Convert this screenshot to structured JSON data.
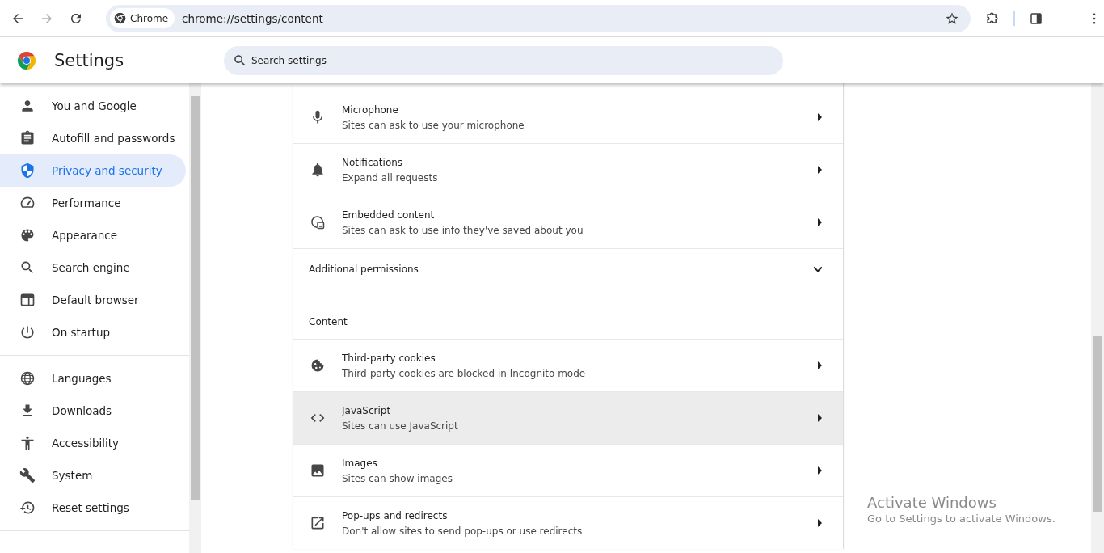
{
  "browser": {
    "nav": [
      {
        "kind": "back",
        "disabled": false
      },
      {
        "kind": "forward",
        "disabled": true
      },
      {
        "kind": "reload",
        "disabled": false
      }
    ],
    "site_chip": "Chrome",
    "url": "chrome://settings/content"
  },
  "header": {
    "title": "Settings",
    "search": {
      "placeholder": "Search settings"
    }
  },
  "sidebar": {
    "groups": [
      {
        "items": [
          {
            "label": "You and Google",
            "selected": false
          },
          {
            "label": "Autofill and passwords",
            "selected": false
          },
          {
            "label": "Privacy and security",
            "selected": true
          },
          {
            "label": "Performance",
            "selected": false
          },
          {
            "label": "Appearance",
            "selected": false
          },
          {
            "label": "Search engine",
            "selected": false
          },
          {
            "label": "Default browser",
            "selected": false
          },
          {
            "label": "On startup",
            "selected": false
          }
        ]
      },
      {
        "items": [
          {
            "label": "Languages",
            "selected": false
          },
          {
            "label": "Downloads",
            "selected": false
          },
          {
            "label": "Accessibility",
            "selected": false
          },
          {
            "label": "System",
            "selected": false
          },
          {
            "label": "Reset settings",
            "selected": false
          }
        ]
      }
    ]
  },
  "content": {
    "items": [
      {
        "kind": "link",
        "title": "Microphone",
        "subtitle": "Sites can ask to use your microphone",
        "highlighted": false
      },
      {
        "kind": "link",
        "title": "Notifications",
        "subtitle": "Expand all requests",
        "highlighted": false
      },
      {
        "kind": "link",
        "title": "Embedded content",
        "subtitle": "Sites can ask to use info they've saved about you",
        "highlighted": false
      },
      {
        "kind": "expander",
        "title": "Additional permissions",
        "expanded": false
      },
      {
        "kind": "heading",
        "title": "Content"
      },
      {
        "kind": "link",
        "title": "Third-party cookies",
        "subtitle": "Third-party cookies are blocked in Incognito mode",
        "highlighted": false
      },
      {
        "kind": "link",
        "title": "JavaScript",
        "subtitle": "Sites can use JavaScript",
        "highlighted": true
      },
      {
        "kind": "link",
        "title": "Images",
        "subtitle": "Sites can show images",
        "highlighted": false
      },
      {
        "kind": "link",
        "title": "Pop-ups and redirects",
        "subtitle": "Don't allow sites to send pop-ups or use redirects",
        "highlighted": false
      }
    ]
  },
  "os_notice": {
    "title": "Activate Windows",
    "text": "Go to Settings to activate Windows."
  }
}
